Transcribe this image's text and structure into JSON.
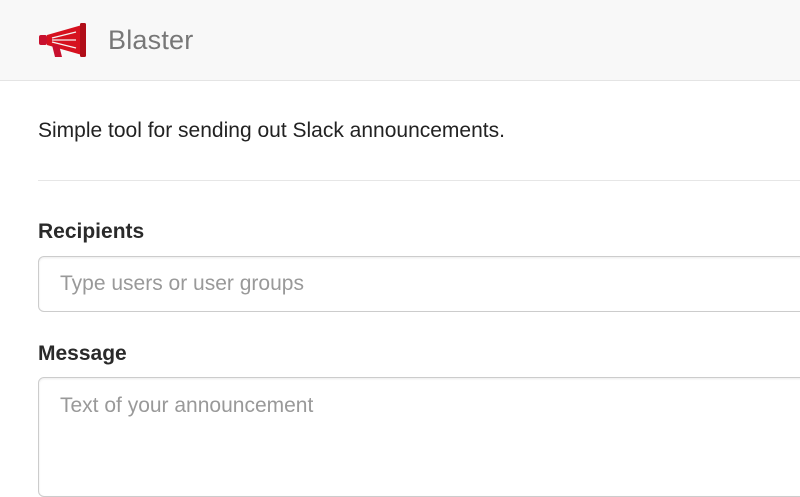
{
  "app": {
    "name": "Blaster",
    "logo_icon": "megaphone-icon",
    "accent_color": "#cc1111"
  },
  "intro": {
    "text": "Simple tool for sending out Slack announcements."
  },
  "form": {
    "recipients": {
      "label": "Recipients",
      "value": "",
      "placeholder": "Type users or user groups"
    },
    "message": {
      "label": "Message",
      "value": "",
      "placeholder": "Text of your announcement"
    }
  }
}
